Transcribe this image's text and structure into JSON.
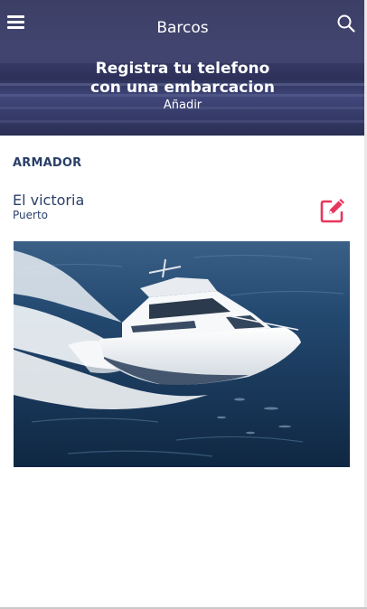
{
  "header": {
    "title": "Barcos",
    "promo_line1": "Registra tu telefono",
    "promo_line2": "con una embarcacion",
    "add_label": "Añadir"
  },
  "icons": {
    "menu": "hamburger-menu-icon",
    "search": "search-icon",
    "edit": "edit-icon"
  },
  "section": {
    "label": "ARMADOR"
  },
  "boat": {
    "name": "El victoria",
    "location": "Puerto"
  },
  "colors": {
    "primary_text": "#2a3f68",
    "edit_accent": "#e8365d",
    "header_bg": "#3d416c"
  }
}
